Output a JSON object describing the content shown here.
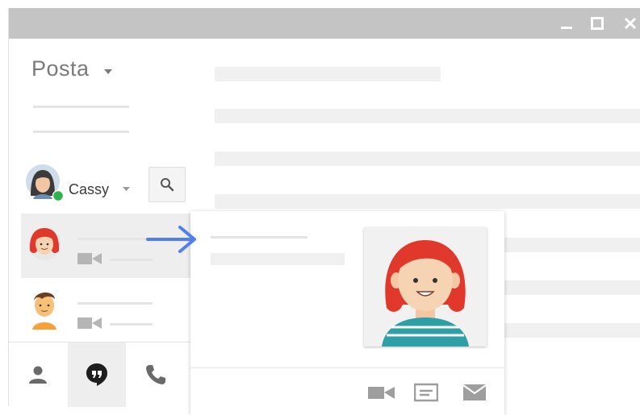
{
  "window": {
    "controls": {
      "minimize_icon": "minimize-icon",
      "maximize_icon": "maximize-icon",
      "close_icon": "close-icon"
    },
    "titlebar_color": "#c4c4c4"
  },
  "sidebar": {
    "title": "Posta",
    "user": {
      "name": "Cassy",
      "status_color": "#2fb34a"
    },
    "contacts": [
      {
        "avatar": "red-haired-girl-avatar",
        "selected": true
      },
      {
        "avatar": "boy-avatar",
        "selected": false
      }
    ],
    "tabs": [
      {
        "icon": "person-icon",
        "active": false
      },
      {
        "icon": "hangouts-icon",
        "active": true
      },
      {
        "icon": "phone-icon",
        "active": false
      }
    ]
  },
  "hover_card": {
    "photo": "red-haired-girl-portrait",
    "actions": [
      "video-call-icon",
      "message-icon",
      "email-icon"
    ]
  },
  "accent_color": "#4f7ff0"
}
